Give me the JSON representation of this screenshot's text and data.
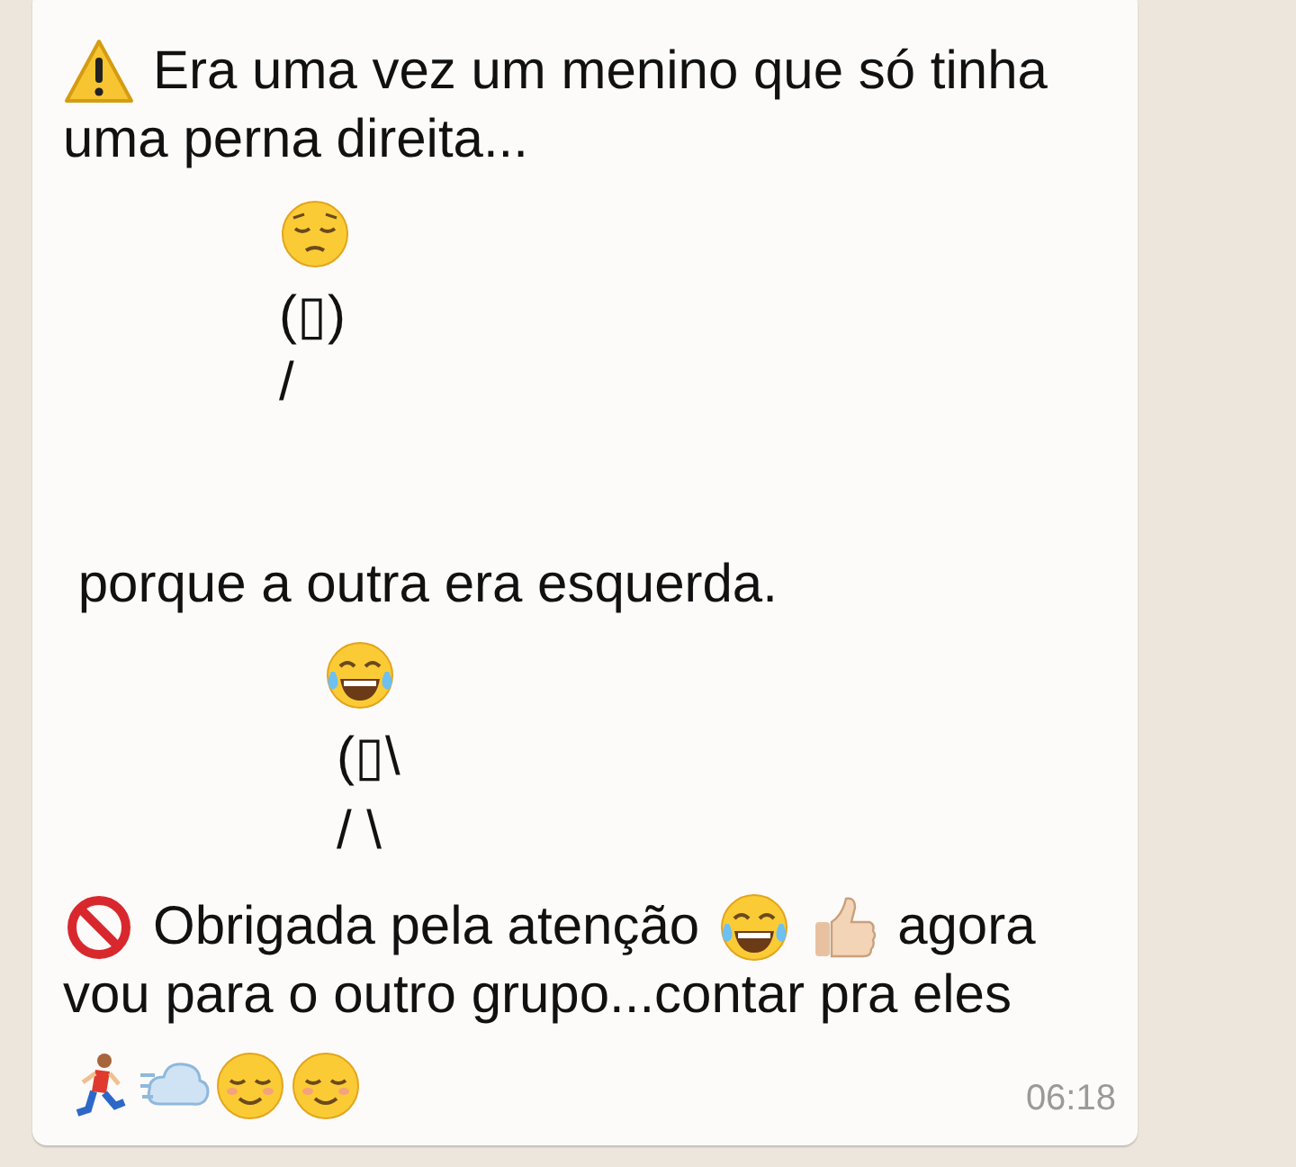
{
  "message": {
    "lines": [
      {
        "parts": [
          {
            "kind": "warning"
          },
          {
            "kind": "text",
            "text": "Era uma vez um menino que só tinha"
          }
        ]
      },
      {
        "parts": [
          {
            "kind": "text",
            "text": "uma perna direita..."
          }
        ]
      },
      {
        "parts": [
          {
            "kind": "pensive"
          }
        ]
      },
      {
        "parts": [
          {
            "kind": "text",
            "text": "(▯)"
          }
        ]
      },
      {
        "parts": [
          {
            "kind": "text",
            "text": "/"
          }
        ]
      },
      {
        "parts": [
          {
            "kind": "text",
            "text": " porque a outra era esquerda."
          }
        ]
      },
      {
        "parts": [
          {
            "kind": "laughing"
          }
        ]
      },
      {
        "parts": [
          {
            "kind": "text",
            "text": "(▯\\"
          }
        ]
      },
      {
        "parts": [
          {
            "kind": "text",
            "text": "/ \\"
          }
        ]
      },
      {
        "parts": [
          {
            "kind": "prohibited"
          },
          {
            "kind": "text",
            "text": "Obrigada pela atenção"
          },
          {
            "kind": "laughing"
          },
          {
            "kind": "thumbs"
          },
          {
            "kind": "text",
            "text": "agora"
          }
        ]
      },
      {
        "parts": [
          {
            "kind": "text",
            "text": "vou para o outro grupo...contar pra eles"
          }
        ]
      },
      {
        "parts": [
          {
            "kind": "runner"
          },
          {
            "kind": "dash"
          },
          {
            "kind": "relieved"
          },
          {
            "kind": "relieved"
          }
        ]
      }
    ],
    "time": "06:18"
  }
}
